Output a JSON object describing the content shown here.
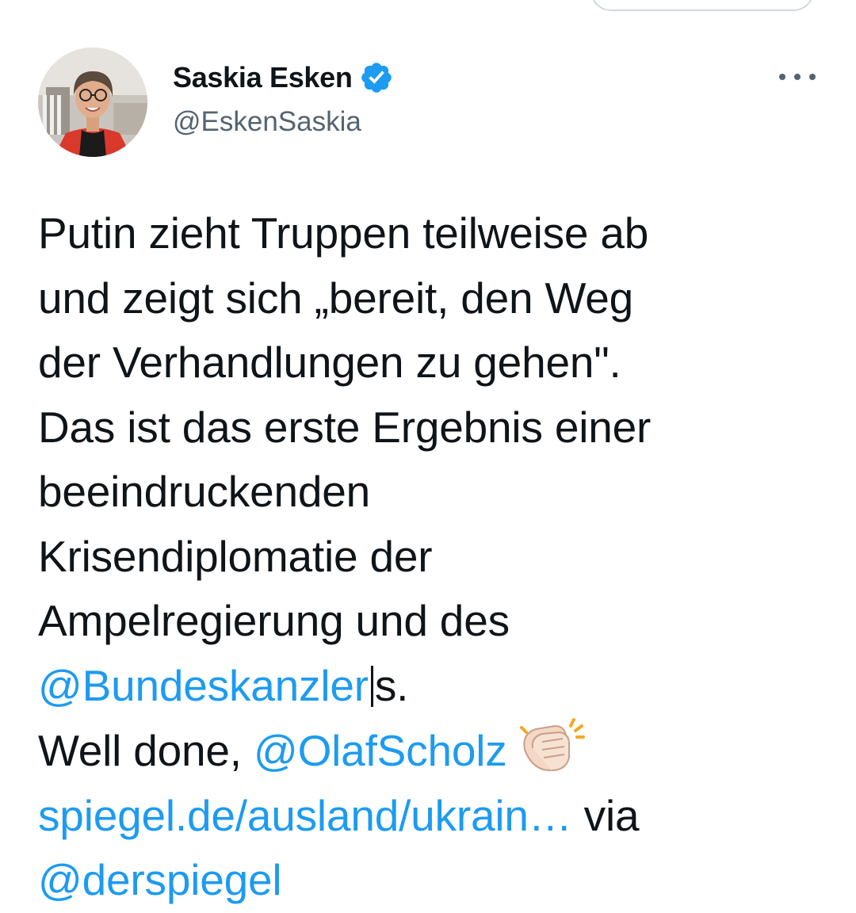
{
  "user": {
    "display_name": "Saskia Esken",
    "handle": "@EskenSaskia",
    "verified": true,
    "avatar_icon": "profile-photo"
  },
  "tweet": {
    "lines": [
      "Putin zieht Truppen teilweise ab",
      "und zeigt sich „bereit, den Weg",
      "der Verhandlungen zu gehen\".",
      "Das ist das erste Ergebnis einer",
      "beeindruckenden",
      "Krisendiplomatie der",
      "Ampelregierung und des"
    ],
    "mention_bundeskanzler": "@Bundeskanzler",
    "mention_suffix": "s.",
    "well_done": "Well done, ",
    "mention_olaf": "@OlafScholz",
    "link_text": "spiegel.de/ausland/ukrain…",
    "via": " via",
    "partial_last": "@derspiegel"
  },
  "icons": {
    "verified": "verified-badge-icon",
    "more": "more-options-icon",
    "emoji": "clapping-hands-emoji"
  },
  "colors": {
    "link": "#1d9bf0",
    "text": "#0f1419",
    "secondary": "#536471"
  }
}
